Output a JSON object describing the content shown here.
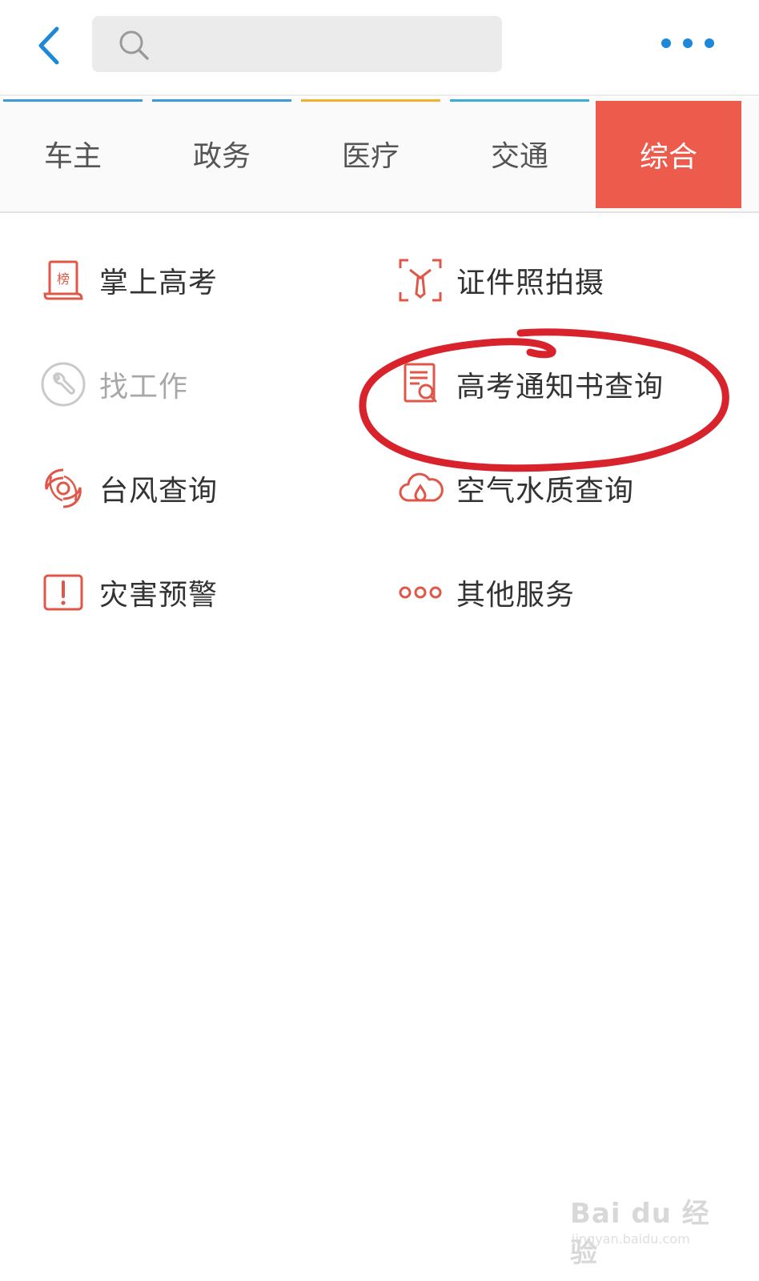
{
  "header": {
    "search": {
      "placeholder": "",
      "value": ""
    },
    "icons": {
      "back": "chevron-left-icon",
      "search": "search-icon",
      "more": "more-dots-icon"
    },
    "accent_color": "#1e88d8"
  },
  "tabs": [
    {
      "label": "车主",
      "accent": "#3b9bd6",
      "active": false
    },
    {
      "label": "政务",
      "accent": "#3b9bd6",
      "active": false
    },
    {
      "label": "医疗",
      "accent": "#f0b030",
      "active": false
    },
    {
      "label": "交通",
      "accent": "#3aaed0",
      "active": false
    },
    {
      "label": "综合",
      "accent": "#ec5b4c",
      "active": true
    }
  ],
  "services": [
    {
      "label": "掌上高考",
      "icon": "ranking-scroll-icon",
      "enabled": true
    },
    {
      "label": "证件照拍摄",
      "icon": "id-photo-icon",
      "enabled": true
    },
    {
      "label": "找工作",
      "icon": "wrench-icon",
      "enabled": false
    },
    {
      "label": "高考通知书查询",
      "icon": "admission-letter-icon",
      "enabled": true
    },
    {
      "label": "台风查询",
      "icon": "typhoon-icon",
      "enabled": true
    },
    {
      "label": "空气水质查询",
      "icon": "air-water-icon",
      "enabled": true
    },
    {
      "label": "灾害预警",
      "icon": "warning-icon",
      "enabled": true
    },
    {
      "label": "其他服务",
      "icon": "more-services-icon",
      "enabled": true
    }
  ],
  "icon_color": "#e0574a",
  "disabled_color": "#bdbdbd",
  "annotation_color": "#d8232c",
  "watermark": {
    "title": "Bai du 经验",
    "subtitle": "jingyan.baidu.com"
  }
}
